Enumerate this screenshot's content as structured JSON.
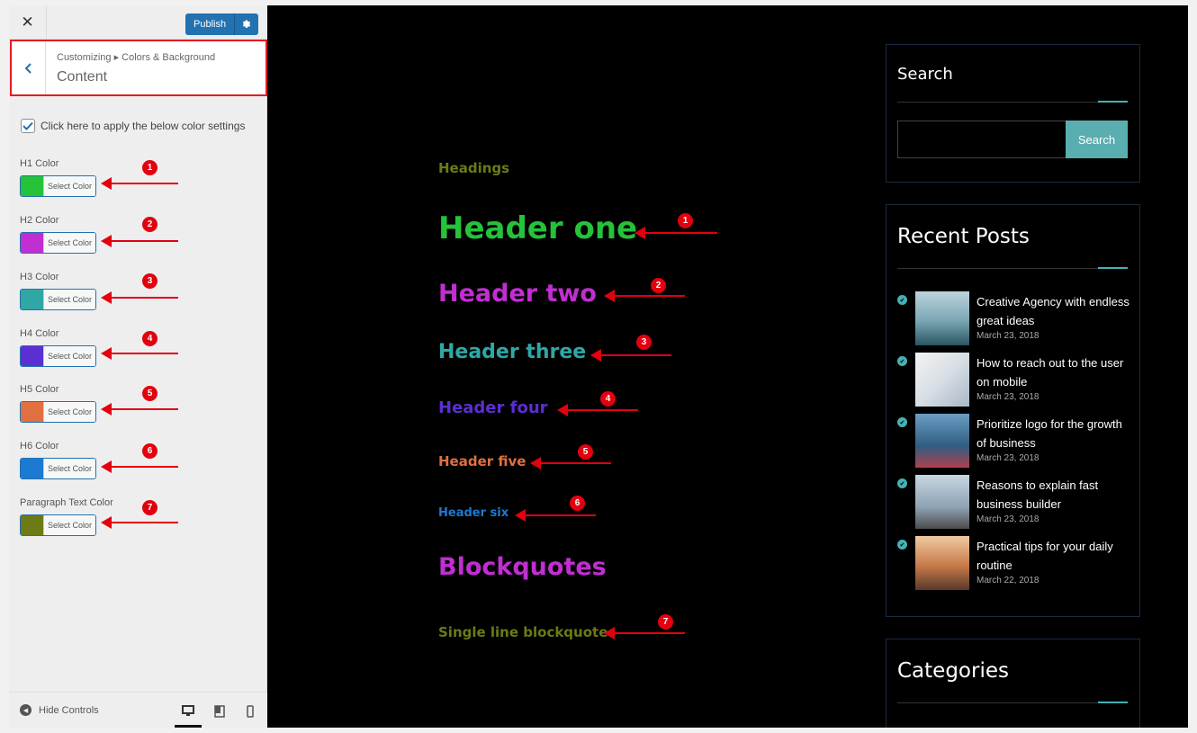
{
  "customizer": {
    "close_label": "✕",
    "publish_label": "Publish",
    "breadcrumb": "Customizing ▸ Colors & Background",
    "section_title": "Content",
    "apply_checkbox_label": "Click here to apply the below color settings",
    "apply_checked": true,
    "controls": [
      {
        "label": "H1 Color",
        "color": "#25c23a",
        "button_text": "Select Color",
        "badge": "1"
      },
      {
        "label": "H2 Color",
        "color": "#c12ed2",
        "button_text": "Select Color",
        "badge": "2"
      },
      {
        "label": "H3 Color",
        "color": "#2fa7a5",
        "button_text": "Select Color",
        "badge": "3"
      },
      {
        "label": "H4 Color",
        "color": "#5b2fd1",
        "button_text": "Select Color",
        "badge": "4"
      },
      {
        "label": "H5 Color",
        "color": "#e0703f",
        "button_text": "Select Color",
        "badge": "5"
      },
      {
        "label": "H6 Color",
        "color": "#1c7ad0",
        "button_text": "Select Color",
        "badge": "6"
      },
      {
        "label": "Paragraph Text Color",
        "color": "#6d7a15",
        "button_text": "Select Color",
        "badge": "7"
      }
    ],
    "footer": {
      "hide_controls": "Hide Controls"
    }
  },
  "preview": {
    "headings_label": "Headings",
    "h1": "Header one",
    "h2": "Header two",
    "h3": "Header three",
    "h4": "Header four",
    "h5": "Header five",
    "h6": "Header six",
    "blockquotes": "Blockquotes",
    "single_line_blockquote": "Single line blockquote",
    "annotation_badges": [
      "1",
      "2",
      "3",
      "4",
      "5",
      "6",
      "7"
    ]
  },
  "sidebar": {
    "search_title": "Search",
    "search_button": "Search",
    "recent_posts_title": "Recent Posts",
    "posts": [
      {
        "title": "Creative Agency with endless great ideas",
        "date": "March 23, 2018"
      },
      {
        "title": "How to reach out to the user on mobile",
        "date": "March 23, 2018"
      },
      {
        "title": "Prioritize logo for the growth of business",
        "date": "March 23, 2018"
      },
      {
        "title": "Reasons to explain fast business builder",
        "date": "March 23, 2018"
      },
      {
        "title": "Practical tips for your daily routine",
        "date": "March 22, 2018"
      }
    ],
    "categories_title": "Categories"
  },
  "colors": {
    "accent": "#45b1b4",
    "annotation_red": "#e3000f",
    "publish_blue": "#2271b1"
  }
}
